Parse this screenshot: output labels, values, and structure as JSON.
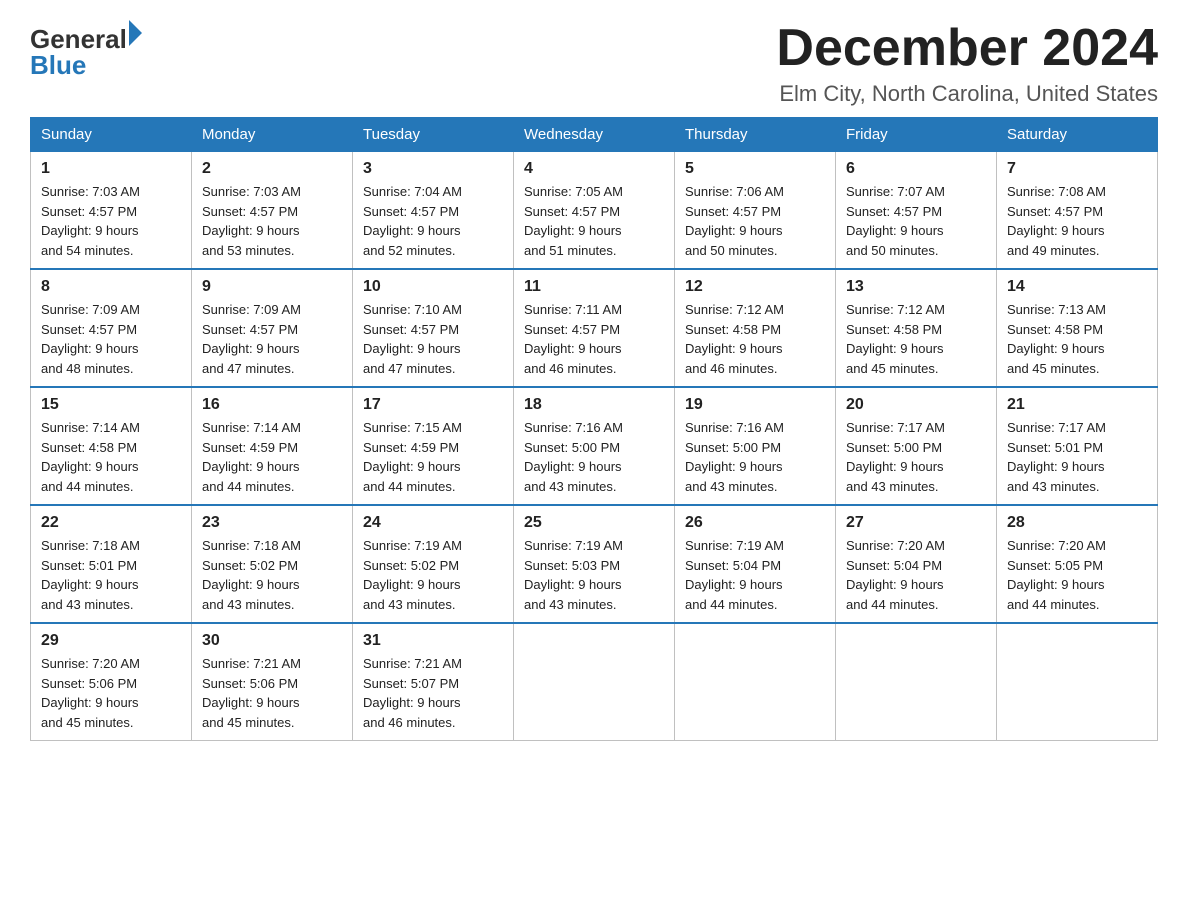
{
  "header": {
    "logo_general": "General",
    "logo_blue": "Blue",
    "month": "December 2024",
    "location": "Elm City, North Carolina, United States"
  },
  "weekdays": [
    "Sunday",
    "Monday",
    "Tuesday",
    "Wednesday",
    "Thursday",
    "Friday",
    "Saturday"
  ],
  "weeks": [
    [
      {
        "day": "1",
        "sunrise": "7:03 AM",
        "sunset": "4:57 PM",
        "daylight": "9 hours and 54 minutes."
      },
      {
        "day": "2",
        "sunrise": "7:03 AM",
        "sunset": "4:57 PM",
        "daylight": "9 hours and 53 minutes."
      },
      {
        "day": "3",
        "sunrise": "7:04 AM",
        "sunset": "4:57 PM",
        "daylight": "9 hours and 52 minutes."
      },
      {
        "day": "4",
        "sunrise": "7:05 AM",
        "sunset": "4:57 PM",
        "daylight": "9 hours and 51 minutes."
      },
      {
        "day": "5",
        "sunrise": "7:06 AM",
        "sunset": "4:57 PM",
        "daylight": "9 hours and 50 minutes."
      },
      {
        "day": "6",
        "sunrise": "7:07 AM",
        "sunset": "4:57 PM",
        "daylight": "9 hours and 50 minutes."
      },
      {
        "day": "7",
        "sunrise": "7:08 AM",
        "sunset": "4:57 PM",
        "daylight": "9 hours and 49 minutes."
      }
    ],
    [
      {
        "day": "8",
        "sunrise": "7:09 AM",
        "sunset": "4:57 PM",
        "daylight": "9 hours and 48 minutes."
      },
      {
        "day": "9",
        "sunrise": "7:09 AM",
        "sunset": "4:57 PM",
        "daylight": "9 hours and 47 minutes."
      },
      {
        "day": "10",
        "sunrise": "7:10 AM",
        "sunset": "4:57 PM",
        "daylight": "9 hours and 47 minutes."
      },
      {
        "day": "11",
        "sunrise": "7:11 AM",
        "sunset": "4:57 PM",
        "daylight": "9 hours and 46 minutes."
      },
      {
        "day": "12",
        "sunrise": "7:12 AM",
        "sunset": "4:58 PM",
        "daylight": "9 hours and 46 minutes."
      },
      {
        "day": "13",
        "sunrise": "7:12 AM",
        "sunset": "4:58 PM",
        "daylight": "9 hours and 45 minutes."
      },
      {
        "day": "14",
        "sunrise": "7:13 AM",
        "sunset": "4:58 PM",
        "daylight": "9 hours and 45 minutes."
      }
    ],
    [
      {
        "day": "15",
        "sunrise": "7:14 AM",
        "sunset": "4:58 PM",
        "daylight": "9 hours and 44 minutes."
      },
      {
        "day": "16",
        "sunrise": "7:14 AM",
        "sunset": "4:59 PM",
        "daylight": "9 hours and 44 minutes."
      },
      {
        "day": "17",
        "sunrise": "7:15 AM",
        "sunset": "4:59 PM",
        "daylight": "9 hours and 44 minutes."
      },
      {
        "day": "18",
        "sunrise": "7:16 AM",
        "sunset": "5:00 PM",
        "daylight": "9 hours and 43 minutes."
      },
      {
        "day": "19",
        "sunrise": "7:16 AM",
        "sunset": "5:00 PM",
        "daylight": "9 hours and 43 minutes."
      },
      {
        "day": "20",
        "sunrise": "7:17 AM",
        "sunset": "5:00 PM",
        "daylight": "9 hours and 43 minutes."
      },
      {
        "day": "21",
        "sunrise": "7:17 AM",
        "sunset": "5:01 PM",
        "daylight": "9 hours and 43 minutes."
      }
    ],
    [
      {
        "day": "22",
        "sunrise": "7:18 AM",
        "sunset": "5:01 PM",
        "daylight": "9 hours and 43 minutes."
      },
      {
        "day": "23",
        "sunrise": "7:18 AM",
        "sunset": "5:02 PM",
        "daylight": "9 hours and 43 minutes."
      },
      {
        "day": "24",
        "sunrise": "7:19 AM",
        "sunset": "5:02 PM",
        "daylight": "9 hours and 43 minutes."
      },
      {
        "day": "25",
        "sunrise": "7:19 AM",
        "sunset": "5:03 PM",
        "daylight": "9 hours and 43 minutes."
      },
      {
        "day": "26",
        "sunrise": "7:19 AM",
        "sunset": "5:04 PM",
        "daylight": "9 hours and 44 minutes."
      },
      {
        "day": "27",
        "sunrise": "7:20 AM",
        "sunset": "5:04 PM",
        "daylight": "9 hours and 44 minutes."
      },
      {
        "day": "28",
        "sunrise": "7:20 AM",
        "sunset": "5:05 PM",
        "daylight": "9 hours and 44 minutes."
      }
    ],
    [
      {
        "day": "29",
        "sunrise": "7:20 AM",
        "sunset": "5:06 PM",
        "daylight": "9 hours and 45 minutes."
      },
      {
        "day": "30",
        "sunrise": "7:21 AM",
        "sunset": "5:06 PM",
        "daylight": "9 hours and 45 minutes."
      },
      {
        "day": "31",
        "sunrise": "7:21 AM",
        "sunset": "5:07 PM",
        "daylight": "9 hours and 46 minutes."
      },
      null,
      null,
      null,
      null
    ]
  ],
  "labels": {
    "sunrise": "Sunrise:",
    "sunset": "Sunset:",
    "daylight": "Daylight:"
  }
}
